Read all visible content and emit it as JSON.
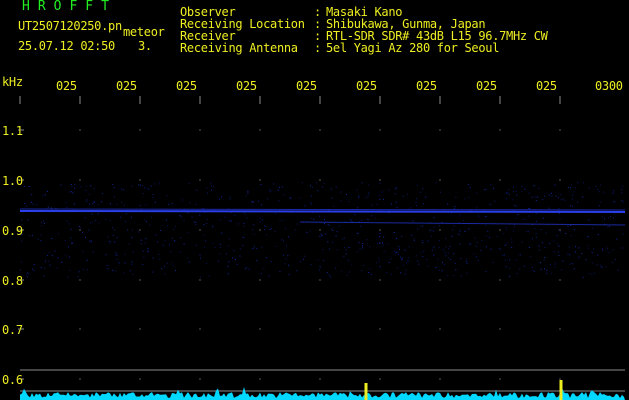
{
  "brand": "HROFFT",
  "file_name": "UT2507120250.pn",
  "label_meteor": "meteor",
  "datetime": "25.07.12 02:50",
  "count": "3.",
  "info": [
    {
      "label": "Observer",
      "value": "Masaki Kano"
    },
    {
      "label": "Receiving Location",
      "value": "Shibukawa, Gunma, Japan"
    },
    {
      "label": "Receiver",
      "value": "RTL-SDR SDR# 43dB L15 96.7MHz CW"
    },
    {
      "label": "Receiving Antenna",
      "value": "5el Yagi Az 280 for Seoul"
    }
  ],
  "separator": ":",
  "y_axis": {
    "unit": "kHz",
    "ticks": [
      "1.1",
      "1.0",
      "0.9",
      "0.8",
      "0.7",
      "0.6"
    ]
  },
  "x_axis": {
    "ticks": [
      "025",
      "025",
      "025",
      "025",
      "025",
      "025",
      "025",
      "025",
      "025",
      "0300"
    ]
  },
  "colors": {
    "title_green": "#22ee22",
    "text_yellow": "#eeee22",
    "trace_blue": "#2a3fe8",
    "noise_cyan": "#00d8ff",
    "grid": "#8a8a8a"
  }
}
